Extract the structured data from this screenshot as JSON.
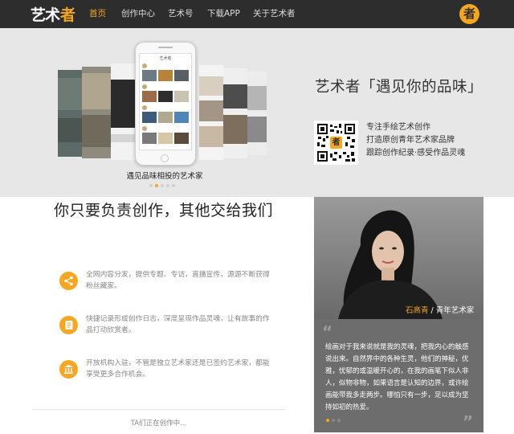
{
  "nav": {
    "logo_main": "艺术",
    "logo_accent": "者",
    "items": [
      "首页",
      "创作中心",
      "艺术号",
      "下载APP",
      "关于艺术者"
    ],
    "active_index": 0,
    "avatar_char": "者"
  },
  "banner": {
    "phone_title": "艺术者",
    "caption": "遇见品味相投的艺术家",
    "slide_count": 5,
    "active_slide": 1,
    "slogan": "艺术者「遇见你的品味」",
    "qr_badge": "者",
    "features": [
      "专注手绘艺术创作",
      "打造原创青年艺术家品牌",
      "跟踪创作纪录·感受作品灵魂"
    ]
  },
  "main": {
    "heading": "你只要负责创作，其他交给我们",
    "features": [
      {
        "icon": "share-icon",
        "text": "全网内容分发，提供专题、专访，直播宣传，源源不断获得粉丝藏家。"
      },
      {
        "icon": "journal-icon",
        "text": "快捷记录形成创作日志，深度呈现作品灵魂，让有故事的作品打动欣赏者。"
      },
      {
        "icon": "institution-icon",
        "text": "开放机构入驻，不管是独立艺术家还是已签约艺术家，都能享受更多合作机会。"
      }
    ],
    "footer": "TA们正在创作中..."
  },
  "artist": {
    "name": "石高青",
    "separator": " / ",
    "title": "青年艺术家",
    "quote": "绘画对于我来说就是我的灵魂，把我内心的触感说出来。自然界中的各种生灵，他们的神秘，优雅，忧郁的或温暖开心的，在我的画笔下似人非人，似物非物，如果语言是认知的边界，或许绘画能带我多走两步。哪怕只有一步，足以成为坚持如初的热爱。",
    "slide_count": 3,
    "active_slide": 0
  },
  "colors": {
    "accent": "#f5a623",
    "nav_bg": "#2d2d2d",
    "banner_bg": "#e7e7e7",
    "quote_bg": "#6d6d6d"
  }
}
